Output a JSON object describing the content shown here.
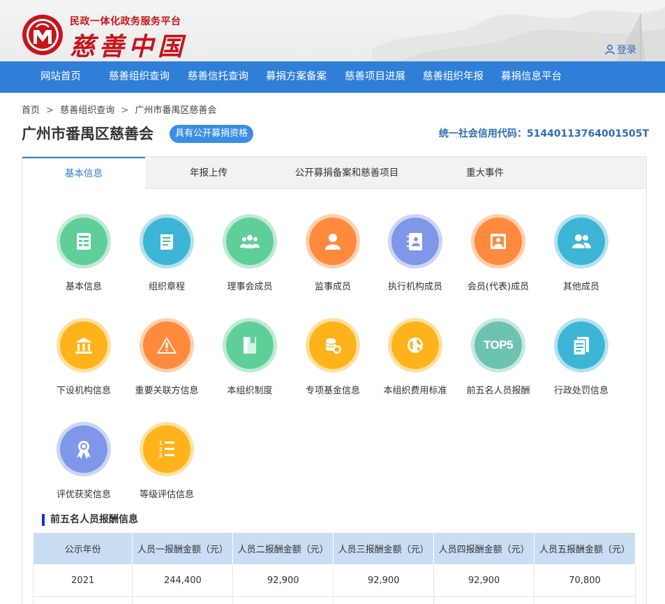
{
  "header": {
    "subtitle": "民政一体化政务服务平台",
    "title": "慈善中国",
    "login_label": "登录"
  },
  "nav": {
    "items": [
      "网站首页",
      "慈善组织查询",
      "慈善信托查询",
      "募捐方案备案",
      "慈善项目进展",
      "慈善组织年报",
      "募捐信息平台"
    ]
  },
  "breadcrumb": {
    "items": [
      "首页",
      "慈善组织查询",
      "广州市番禺区慈善会"
    ],
    "separator": ">"
  },
  "org": {
    "name": "广州市番禺区慈善会",
    "badge": "具有公开募捐资格",
    "credit_code": "统一社会信用代码：51440113764001505T"
  },
  "tabs": [
    "基本信息",
    "年报上传",
    "公开募捐备案和慈善项目",
    "重大事件"
  ],
  "active_tab": 0,
  "icons": [
    {
      "label": "基本信息",
      "icon": "document-list-icon",
      "color": "#5fcf9a",
      "ring": "#bdebd3"
    },
    {
      "label": "组织章程",
      "icon": "scroll-icon",
      "color": "#3db5d6",
      "ring": "#b3e2ef"
    },
    {
      "label": "理事会成员",
      "icon": "group-icon",
      "color": "#5fcf9a",
      "ring": "#bdebd3"
    },
    {
      "label": "监事成员",
      "icon": "person-icon",
      "color": "#ff8a3d",
      "ring": "#ffd0ae"
    },
    {
      "label": "执行机构成员",
      "icon": "id-book-icon",
      "color": "#7f97e8",
      "ring": "#cbd5f6"
    },
    {
      "label": "会员(代表)成员",
      "icon": "portrait-frame-icon",
      "color": "#ff8a3d",
      "ring": "#ffd0ae"
    },
    {
      "label": "其他成员",
      "icon": "users-icon",
      "color": "#3db5d6",
      "ring": "#b3e2ef"
    },
    {
      "label": "下设机构信息",
      "icon": "institution-icon",
      "color": "#ffb31a",
      "ring": "#ffe0a0"
    },
    {
      "label": "重要关联方信息",
      "icon": "warning-icon",
      "color": "#ff8a3d",
      "ring": "#ffd0ae"
    },
    {
      "label": "本组织制度",
      "icon": "book-icon",
      "color": "#5fcf9a",
      "ring": "#bdebd3"
    },
    {
      "label": "专项基金信息",
      "icon": "coins-icon",
      "color": "#ffb31a",
      "ring": "#ffe0a0"
    },
    {
      "label": "本组织费用标准",
      "icon": "globe-icon",
      "color": "#ffb31a",
      "ring": "#ffe0a0"
    },
    {
      "label": "前五名人员报酬",
      "icon": "top5-icon",
      "color": "#6cc4b0",
      "ring": "#c5e9e0"
    },
    {
      "label": "行政处罚信息",
      "icon": "documents-icon",
      "color": "#3db5d6",
      "ring": "#b3e2ef"
    },
    {
      "label": "评优获奖信息",
      "icon": "medal-icon",
      "color": "#7f97e8",
      "ring": "#cbd5f6"
    },
    {
      "label": "等级评估信息",
      "icon": "numbered-list-icon",
      "color": "#ffb31a",
      "ring": "#ffe0a0"
    }
  ],
  "top5_text": "TOP5",
  "list_digits": "123",
  "section": {
    "title": "前五名人员报酬信息"
  },
  "pay_table": {
    "headers": [
      "公示年份",
      "人员一报酬金额（元）",
      "人员二报酬金额（元）",
      "人员三报酬金额（元）",
      "人员四报酬金额（元）",
      "人员五报酬金额（元）"
    ],
    "rows": [
      [
        "2021",
        "244,400",
        "92,900",
        "92,900",
        "92,900",
        "70,800"
      ]
    ]
  },
  "colors": {
    "nav_bg": "#2f7ed8",
    "brand_red": "#c8141b",
    "badge_bg": "#3a8ee6",
    "table_header": "#c9ddf3"
  }
}
